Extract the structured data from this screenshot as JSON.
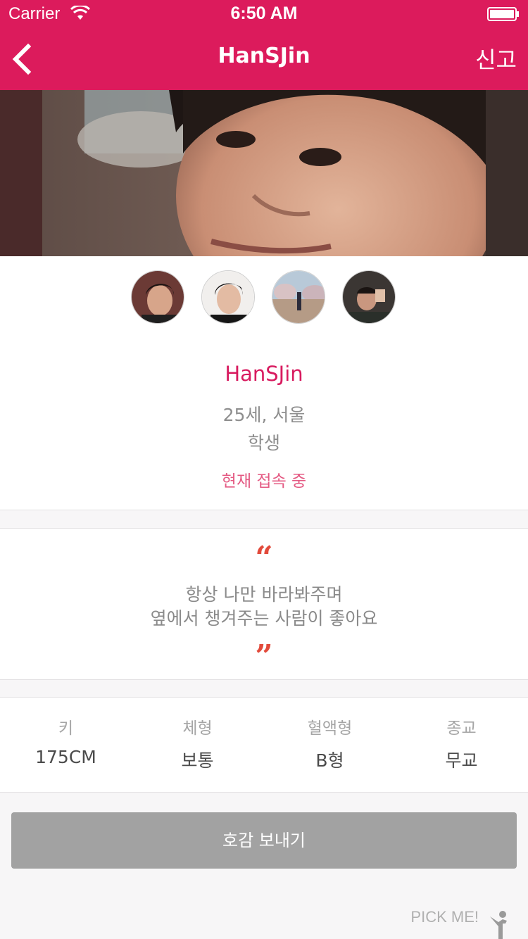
{
  "status": {
    "carrier": "Carrier",
    "time": "6:50 AM"
  },
  "nav": {
    "title": "HanSJin",
    "report_label": "신고"
  },
  "profile": {
    "name": "HanSJin",
    "age_location": "25세, 서울",
    "occupation": "학생",
    "online_status": "현재 접속 중",
    "photos": [
      "photo-1",
      "photo-2",
      "photo-3",
      "photo-4"
    ]
  },
  "quote": {
    "open_mark": "“",
    "close_mark": "”",
    "line1": "항상 나만 바라봐주며",
    "line2": "옆에서 챙겨주는 사람이 좋아요"
  },
  "stats": [
    {
      "label": "키",
      "value": "175CM"
    },
    {
      "label": "체형",
      "value": "보통"
    },
    {
      "label": "혈액형",
      "value": "B형"
    },
    {
      "label": "종교",
      "value": "무교"
    }
  ],
  "actions": {
    "send_like_label": "호감 보내기",
    "pick_me_label": "PICK ME!"
  },
  "colors": {
    "brand": "#dc1b5c",
    "accent_text": "#d81b5f",
    "quote_mark": "#e24a3b",
    "button": "#a2a2a2"
  }
}
